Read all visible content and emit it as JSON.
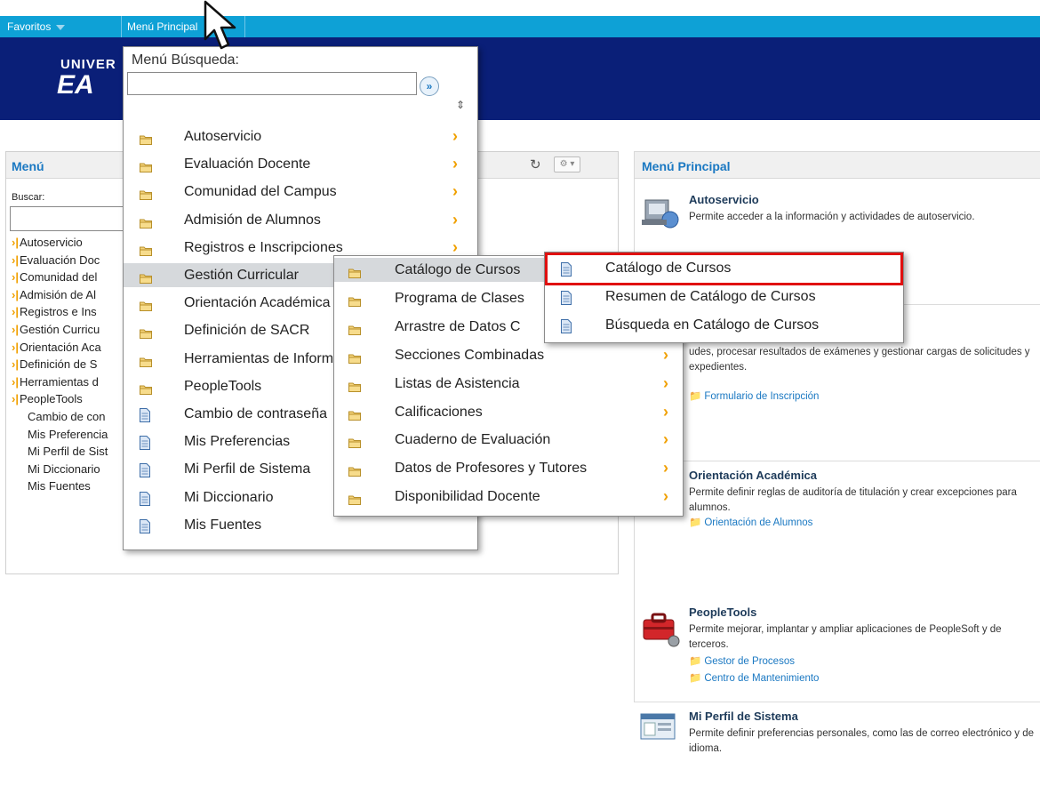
{
  "nav": {
    "favorites": "Favoritos",
    "main_menu": "Menú Principal"
  },
  "banner": {
    "logo_line1": "UNIVER",
    "logo_line2": "EA"
  },
  "left_pagelet": {
    "title": "Menú",
    "search_label": "Buscar:",
    "items": [
      {
        "label": "Autoservicio",
        "folder": true
      },
      {
        "label": "Evaluación Doc",
        "folder": true
      },
      {
        "label": "Comunidad del",
        "folder": true
      },
      {
        "label": "Admisión de Al",
        "folder": true
      },
      {
        "label": "Registros e Ins",
        "folder": true
      },
      {
        "label": "Gestión Curricu",
        "folder": true
      },
      {
        "label": "Orientación Aca",
        "folder": true
      },
      {
        "label": "Definición de S",
        "folder": true
      },
      {
        "label": "Herramientas d",
        "folder": true
      },
      {
        "label": "PeopleTools",
        "folder": true
      },
      {
        "label": "Cambio de con",
        "folder": false
      },
      {
        "label": "Mis Preferencia",
        "folder": false
      },
      {
        "label": "Mi Perfil de Sist",
        "folder": false
      },
      {
        "label": "Mi Diccionario",
        "folder": false
      },
      {
        "label": "Mis Fuentes",
        "folder": false
      }
    ]
  },
  "right_pagelet": {
    "title": "Menú Principal",
    "sections": [
      {
        "title": "Autoservicio",
        "desc": "Permite acceder a la información y actividades de autoservicio.",
        "links": []
      },
      {
        "title": "",
        "desc": "udes, procesar resultados de exámenes y gestionar cargas de solicitudes y expedientes.",
        "links": [
          "Formulario de Inscripción"
        ]
      },
      {
        "title": "Orientación Académica",
        "desc": "Permite definir reglas de auditoría de titulación y crear excepciones para alumnos.",
        "links": [
          "Orientación de Alumnos"
        ]
      },
      {
        "title": "PeopleTools",
        "desc": "Permite mejorar, implantar y ampliar aplicaciones de PeopleSoft y de terceros.",
        "links": [
          "Gestor de Procesos",
          "Centro de Mantenimiento"
        ]
      },
      {
        "title": "Mi Perfil de Sistema",
        "desc": "Permite definir preferencias personales, como las de correo electrónico y de idioma.",
        "links": []
      }
    ]
  },
  "menu1": {
    "search_label": "Menú Búsqueda:",
    "go": "»",
    "sort": "⇕",
    "items": [
      {
        "label": "Autoservicio",
        "folder": true
      },
      {
        "label": "Evaluación Docente",
        "folder": true
      },
      {
        "label": "Comunidad del Campus",
        "folder": true
      },
      {
        "label": "Admisión de Alumnos",
        "folder": true
      },
      {
        "label": "Registros e Inscripciones",
        "folder": true
      },
      {
        "label": "Gestión Curricular",
        "folder": true,
        "highlighted": true
      },
      {
        "label": "Orientación Académica",
        "folder": true
      },
      {
        "label": "Definición de SACR",
        "folder": true
      },
      {
        "label": "Herramientas de Informe",
        "folder": true
      },
      {
        "label": "PeopleTools",
        "folder": true
      },
      {
        "label": "Cambio de contraseña",
        "folder": false
      },
      {
        "label": "Mis Preferencias",
        "folder": false
      },
      {
        "label": "Mi Perfil de Sistema",
        "folder": false
      },
      {
        "label": "Mi Diccionario",
        "folder": false
      },
      {
        "label": "Mis Fuentes",
        "folder": false
      }
    ]
  },
  "menu2": {
    "items": [
      {
        "label": "Catálogo de Cursos",
        "highlighted": true
      },
      {
        "label": "Programa de Clases"
      },
      {
        "label": "Arrastre de Datos C"
      },
      {
        "label": "Secciones Combinadas"
      },
      {
        "label": "Listas de Asistencia"
      },
      {
        "label": "Calificaciones"
      },
      {
        "label": "Cuaderno de Evaluación"
      },
      {
        "label": "Datos de Profesores y Tutores"
      },
      {
        "label": "Disponibilidad Docente"
      }
    ]
  },
  "menu3": {
    "items": [
      {
        "label": "Catálogo de Cursos"
      },
      {
        "label": "Resumen de Catálogo de Cursos"
      },
      {
        "label": "Búsqueda en Catálogo de Cursos"
      }
    ]
  },
  "colors": {
    "nav": "#0ea1d6",
    "banner": "#0a1f78",
    "link": "#1a78c2",
    "chevron": "#f0a000",
    "highlight_box": "#e01010"
  }
}
